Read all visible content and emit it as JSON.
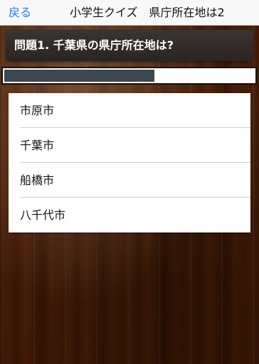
{
  "nav": {
    "back_label": "戻る",
    "title": "小学生クイズ　県庁所在地は2"
  },
  "question": {
    "text": "問題1. 千葉県の県庁所在地は?"
  },
  "timer": {
    "remaining_fraction": 0.6
  },
  "answers": [
    {
      "label": "市原市"
    },
    {
      "label": "千葉市"
    },
    {
      "label": "船橋市"
    },
    {
      "label": "八千代市"
    }
  ],
  "colors": {
    "accent": "#1e7cf2",
    "timer_fill": "#3c4751",
    "question_bg": "#2f2a26"
  }
}
